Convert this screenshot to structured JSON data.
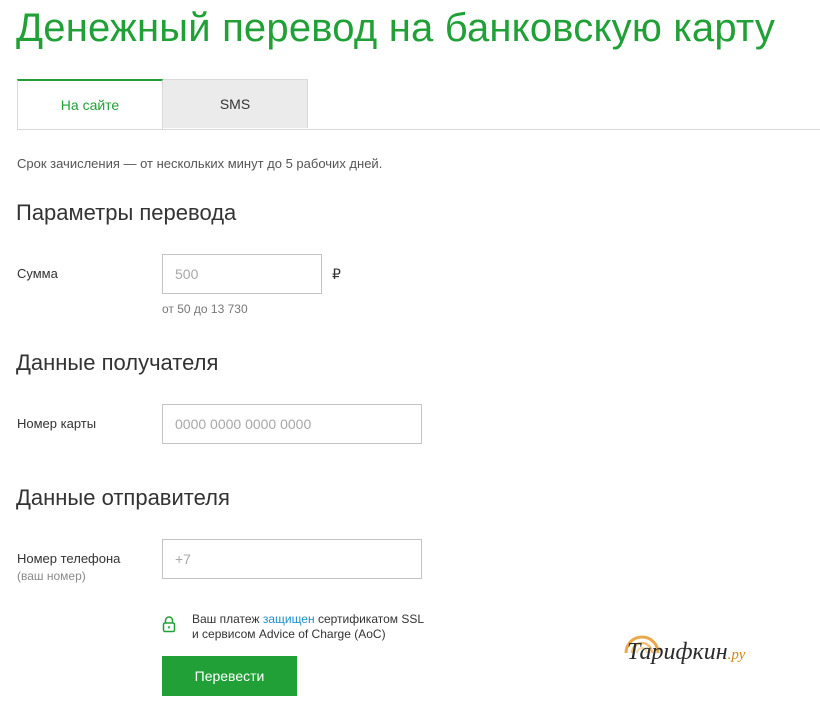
{
  "page": {
    "title": "Денежный перевод на банковскую карту"
  },
  "tabs": [
    {
      "label": "На сайте",
      "active": true
    },
    {
      "label": "SMS",
      "active": false
    }
  ],
  "note": "Срок зачисления — от нескольких минут до 5 рабочих дней.",
  "transfer_params": {
    "title": "Параметры перевода",
    "amount_label": "Сумма",
    "amount_placeholder": "500",
    "currency": "₽",
    "amount_hint": "от 50 до 13 730"
  },
  "recipient": {
    "title": "Данные получателя",
    "card_label": "Номер карты",
    "card_placeholder": "0000 0000 0000 0000"
  },
  "sender": {
    "title": "Данные отправителя",
    "phone_label": "Номер телефона",
    "phone_sublabel": "(ваш номер)",
    "phone_placeholder": "+7"
  },
  "security": {
    "text_before_link": "Ваш платеж ",
    "link": "защищен",
    "text_after_link": " сертификатом SSL",
    "line2": "и сервисом Advice of Charge (AoC)",
    "icon": "lock-icon"
  },
  "submit": {
    "label": "Перевести"
  },
  "watermark": {
    "name": "Тарифкин",
    "domain": ".ру"
  },
  "colors": {
    "accent": "#21a038",
    "link": "#1a8fcc",
    "watermark_accent": "#d4880f"
  }
}
